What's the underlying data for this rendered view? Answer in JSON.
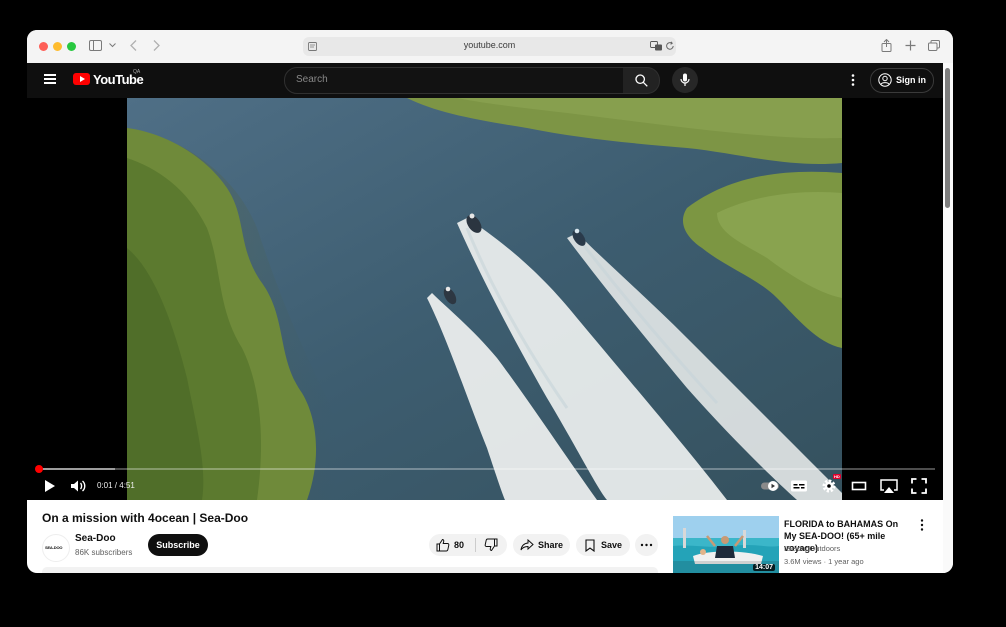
{
  "browser": {
    "url": "youtube.com",
    "icons": [
      "sidebar-icon",
      "chevron-down-icon",
      "back-icon",
      "forward-icon",
      "page-icon",
      "translate-icon",
      "reload-icon",
      "share-icon",
      "new-tab-icon",
      "tabs-icon"
    ]
  },
  "header": {
    "logo_text": "YouTube",
    "country_code": "QA",
    "search_placeholder": "Search",
    "sign_in_label": "Sign in"
  },
  "player": {
    "current_time": "0:01",
    "duration": "4:51",
    "time_display": "0:01 / 4:51",
    "played_fraction": 0.004,
    "buffered_fraction": 0.085,
    "hd_badge": "HD",
    "controls": [
      "play-icon",
      "volume-icon",
      "autoplay-toggle-icon",
      "subtitles-icon",
      "settings-icon",
      "theater-mode-icon",
      "airplay-icon",
      "fullscreen-icon"
    ]
  },
  "video": {
    "title": "On a mission with 4ocean | Sea-Doo",
    "channel_logo_text": "SEA-DOO",
    "channel_name": "Sea-Doo",
    "subscribers": "86K subscribers",
    "subscribe_label": "Subscribe",
    "likes": "80",
    "share_label": "Share",
    "save_label": "Save"
  },
  "recommended": [
    {
      "title": "FLORIDA to BAHAMAS On My SEA-DOO! (65+ mile voyage)",
      "channel": "IBelongOutdoors",
      "views": "3.6M views",
      "age": "1 year ago",
      "meta": "3.6M views · 1 year ago",
      "duration": "14:07"
    }
  ],
  "colors": {
    "youtube_red": "#ff0000",
    "header_bg": "#0f0f0f",
    "subscribe_bg": "#0f0f0f",
    "pill_bg": "#f2f2f2"
  }
}
